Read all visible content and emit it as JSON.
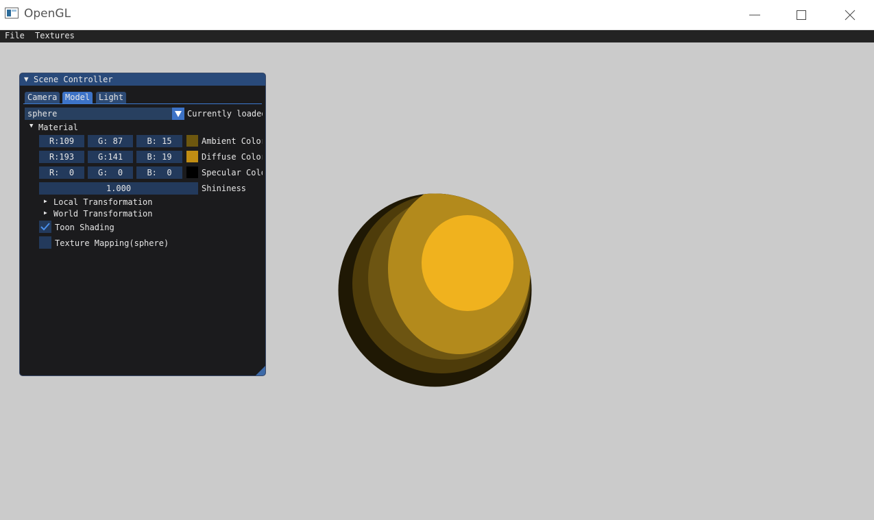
{
  "window": {
    "title": "OpenGL"
  },
  "menu": {
    "file": "File",
    "textures": "Textures"
  },
  "panel": {
    "title": "Scene Controller",
    "tabs": [
      {
        "label": "Camera"
      },
      {
        "label": "Model"
      },
      {
        "label": "Light"
      }
    ],
    "model_select": {
      "value": "sphere",
      "status": "Currently loaded"
    },
    "material": {
      "header": "Material",
      "ambient": {
        "r": "R:109",
        "g": "G: 87",
        "b": "B: 15",
        "label": "Ambient Color",
        "color": "#6d570f"
      },
      "diffuse": {
        "r": "R:193",
        "g": "G:141",
        "b": "B: 19",
        "label": "Diffuse Color",
        "color": "#c18d13"
      },
      "specular": {
        "r": "R:  0",
        "g": "G:  0",
        "b": "B:  0",
        "label": "Specular  Color",
        "color": "#000000"
      },
      "shininess": {
        "value": "1.000",
        "label": "Shininess"
      }
    },
    "local_transform": "Local Transformation",
    "world_transform": "World Transformation",
    "toon_shading": {
      "label": "Toon Shading",
      "checked": true
    },
    "texture_mapping": {
      "label": "Texture Mapping(sphere)",
      "checked": false
    }
  },
  "colors": {
    "accent": "#3d73c7",
    "sphere_highlight": "#f0b21e",
    "sphere_mid": "#b48a1c",
    "sphere_dark": "#6d5512"
  }
}
